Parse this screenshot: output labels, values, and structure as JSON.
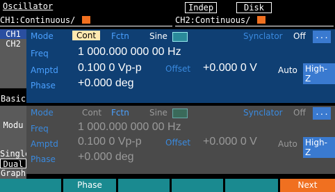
{
  "header": {
    "title": "Oscillator",
    "indep": "Indep",
    "disk": "Disk",
    "ch1_status": "CH1:Continuous/",
    "ch2_status": "CH2:Continuous/"
  },
  "tabs": {
    "ch1": "CH1",
    "ch2": "CH2",
    "basic": "Basic",
    "modu": "Modu",
    "single": "Single",
    "dual": "Dual",
    "graph": "Graph"
  },
  "ch1": {
    "mode_label": "Mode",
    "mode_value": "Cont",
    "fctn_label": "Fctn",
    "fctn_value": "Sine",
    "synclator_label": "Synclator",
    "synclator_value": "Off",
    "more_label": "...",
    "freq_label": "Freq",
    "freq_value": "1 000.000 000 00 Hz",
    "amptd_label": "Amptd",
    "amptd_value": "0.100 0 Vp-p",
    "offset_label": "Offset",
    "offset_value": "+0.000 0 V",
    "load_auto": "Auto",
    "load_value": "High-Z",
    "phase_label": "Phase",
    "phase_value": "+0.000 deg"
  },
  "ch2": {
    "mode_label": "Mode",
    "mode_value": "Cont",
    "fctn_label": "Fctn",
    "fctn_value": "Sine",
    "synclator_label": "Synclator",
    "synclator_value": "Off",
    "more_label": "...",
    "freq_label": "Freq",
    "freq_value": "1 000.000 000 00 Hz",
    "amptd_label": "Amptd",
    "amptd_value": "0.100 0 Vp-p",
    "offset_label": "Offset",
    "offset_value": "+0.000 0 V",
    "load_auto": "Auto",
    "load_value": "High-Z",
    "phase_label": "Phase",
    "phase_value": "+0.000 deg"
  },
  "softkeys": [
    "",
    "Phase",
    "",
    "",
    "",
    "Next"
  ],
  "colors": {
    "ch1_panel": "#0f3f73",
    "ch2_panel": "#4a4a4a",
    "label_blue": "#4aa0ff",
    "softkey_teal": "#1a8a90",
    "next_orange": "#f07020"
  }
}
